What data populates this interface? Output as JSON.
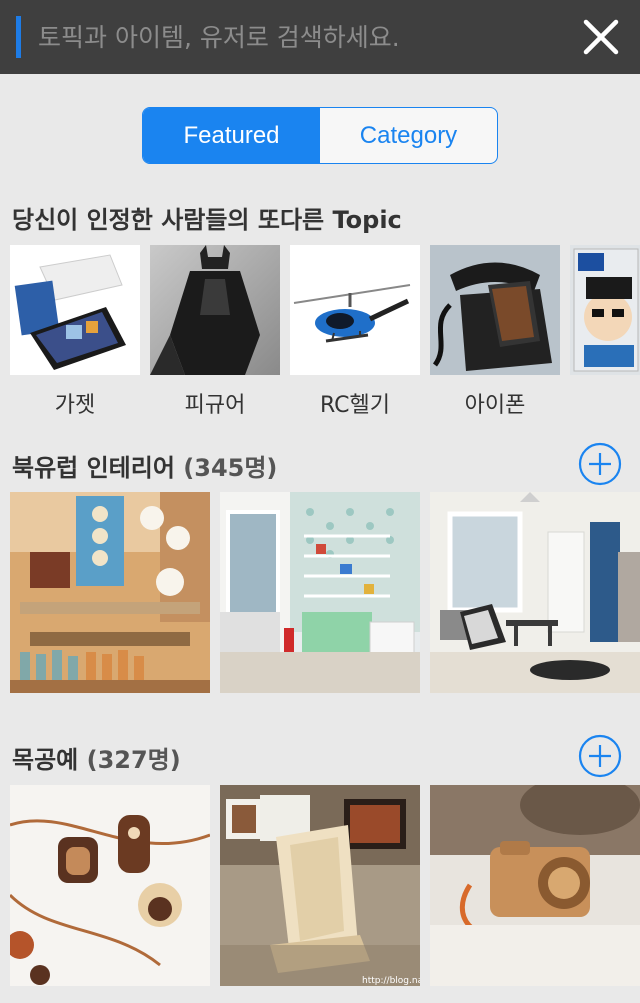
{
  "search": {
    "placeholder": "토픽과 아이템, 유저로 검색하세요."
  },
  "tabs": {
    "featured": "Featured",
    "category": "Category"
  },
  "topics_section": {
    "title": "당신이 인정한 사람들의 또다른 Topic",
    "items": [
      {
        "label": "가젯"
      },
      {
        "label": "피규어"
      },
      {
        "label": "RC헬기"
      },
      {
        "label": "아이폰"
      },
      {
        "label": ""
      }
    ]
  },
  "collection1": {
    "title": "북유럽 인테리어",
    "count": "(345명)"
  },
  "collection2": {
    "title": "목공예",
    "count": "(327명)",
    "watermark": "http://blog.nav"
  },
  "colors": {
    "accent": "#1a84f0",
    "search_bg": "#3f3f3f",
    "page_bg": "#e9e9e9"
  }
}
